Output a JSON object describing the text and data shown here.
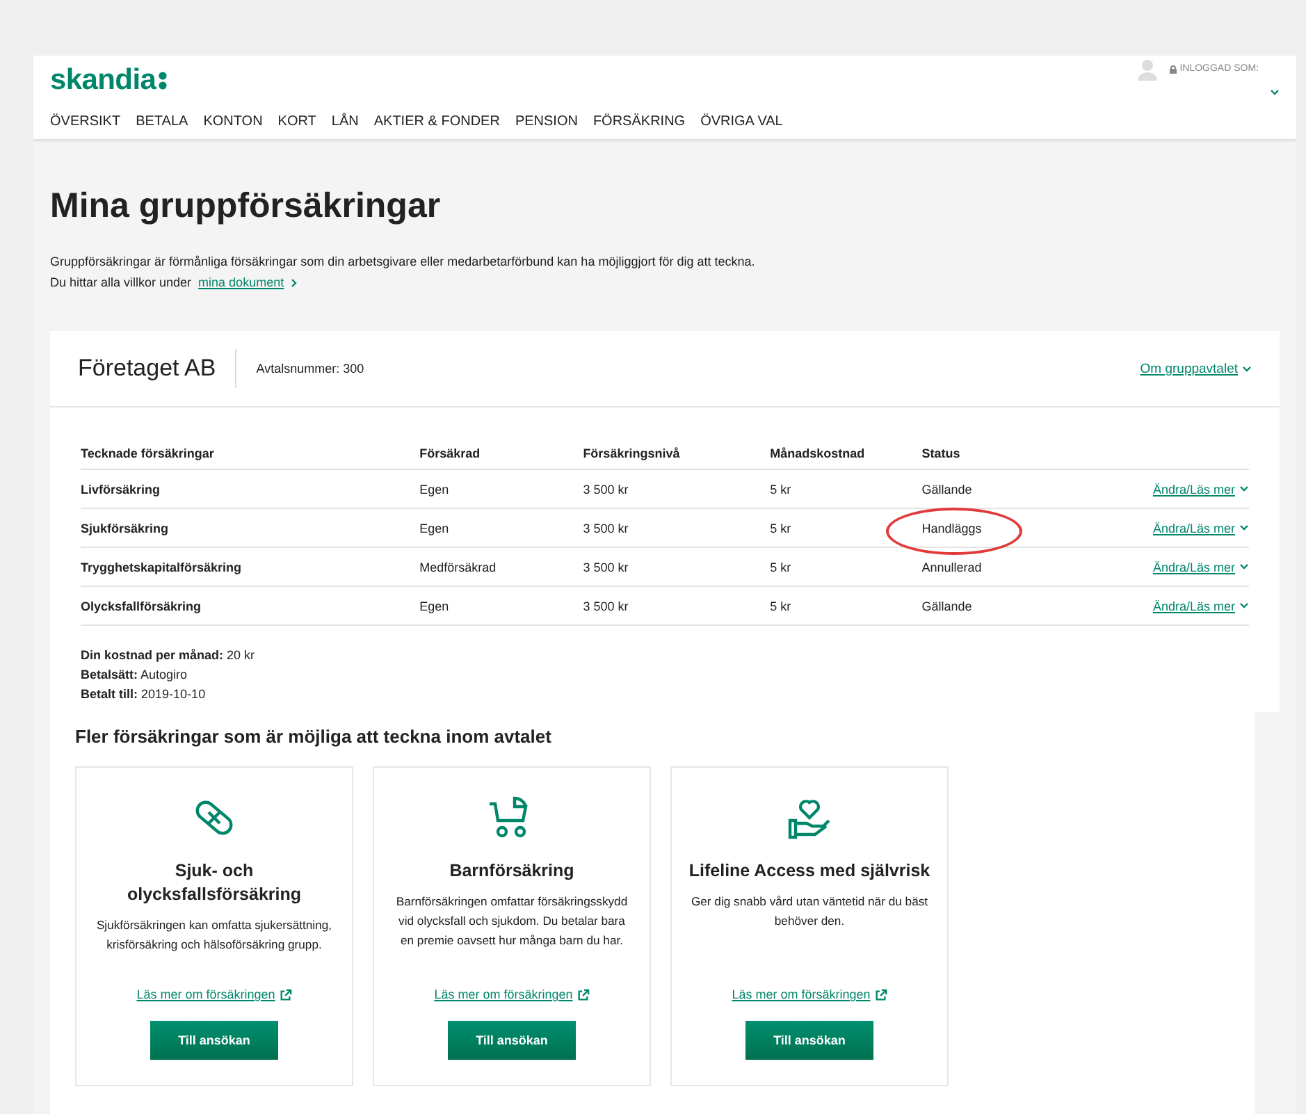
{
  "header": {
    "logo": "skandia",
    "login_label": "INLOGGAD SOM:",
    "nav": [
      {
        "label": "ÖVERSIKT",
        "selected": false
      },
      {
        "label": "BETALA",
        "selected": false
      },
      {
        "label": "KONTON",
        "selected": false
      },
      {
        "label": "KORT",
        "selected": false
      },
      {
        "label": "LÅN",
        "selected": false
      },
      {
        "label": "AKTIER & FONDER",
        "selected": false
      },
      {
        "label": "PENSION",
        "selected": false
      },
      {
        "label": "FÖRSÄKRING",
        "selected": false
      },
      {
        "label": "ÖVRIGA VAL",
        "selected": false
      }
    ]
  },
  "title": "Mina gruppförsäkringar",
  "intro": "Gruppförsäkringar är förmånliga försäkringar som din arbetsgivare eller medarbetarförbund kan ha möjliggjort för dig att teckna.",
  "intro_link_prefix": "Du hittar alla villkor under",
  "intro_link": "mina dokument",
  "company": {
    "name": "Företaget AB",
    "agreement": "Avtalsnummer: 300",
    "agreement_link": "Om gruppavtalet"
  },
  "table": {
    "columns": [
      "Tecknade försäkringar",
      "Försäkrad",
      "Försäkringsnivå",
      "Månadskostnad",
      "Status"
    ],
    "rows": [
      {
        "name": "Livförsäkring",
        "insured": "Egen",
        "level": "3 500 kr",
        "cost": "5 kr",
        "status": "Gällande",
        "circled": false,
        "action": "Ändra/Läs mer"
      },
      {
        "name": "Sjukförsäkring",
        "insured": "Egen",
        "level": "3 500 kr",
        "cost": "5 kr",
        "status": "Handläggs",
        "circled": true,
        "action": "Ändra/Läs mer"
      },
      {
        "name": "Trygghetskapitalförsäkring",
        "insured": "Medförsäkrad",
        "level": "3 500 kr",
        "cost": "5 kr",
        "status": "Annullerad",
        "circled": false,
        "action": "Ändra/Läs mer"
      },
      {
        "name": "Olycksfallförsäkring",
        "insured": "Egen",
        "level": "3 500 kr",
        "cost": "5 kr",
        "status": "Gällande",
        "circled": false,
        "action": "Ändra/Läs mer"
      }
    ]
  },
  "summary": [
    {
      "label": "Din kostnad per månad:",
      "value": "20 kr"
    },
    {
      "label": "Betalsätt:",
      "value": "Autogiro"
    },
    {
      "label": "Betalt till:",
      "value": "2019-10-10"
    }
  ],
  "more_title": "Fler försäkringar som är möjliga att teckna inom avtalet",
  "offers": [
    {
      "kind": "bandage",
      "title": "Sjuk- och olycksfallsförsäkring",
      "text": "Sjukförsäkringen kan omfatta sjukersättning, krisförsäkring och hälsoförsäkring grupp.",
      "link": "Läs mer om försäkringen",
      "button": "Till ansökan"
    },
    {
      "kind": "stroller",
      "title": "Barnförsäkring",
      "text": "Barnförsäkringen omfattar försäkringsskydd vid olycksfall och sjukdom. Du betalar bara en premie oavsett hur många barn du har.",
      "link": "Läs mer om försäkringen",
      "button": "Till ansökan"
    },
    {
      "kind": "heart-hand",
      "title": "Lifeline Access med självrisk",
      "text": "Ger dig snabb vård utan väntetid när du bäst behöver den.",
      "link": "Läs mer om försäkringen",
      "button": "Till ansökan"
    }
  ]
}
